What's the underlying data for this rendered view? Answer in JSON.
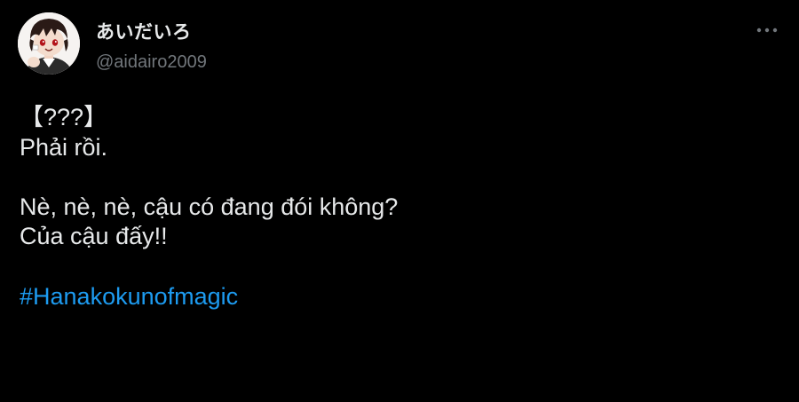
{
  "tweet": {
    "author": {
      "display_name": "あいだいろ",
      "handle": "@aidairo2009"
    },
    "more_icon": "more-horizontal-icon",
    "lines": {
      "l1": "【???】",
      "l2": "Phải rồi.",
      "l3": "Nè, nè, nè, cậu có đang đói không?",
      "l4": "Của cậu đấy!!"
    },
    "hashtag": "#Hanakokunofmagic"
  },
  "colors": {
    "background": "#000000",
    "text": "#e7e9ea",
    "handle": "#71767b",
    "hashtag": "#1d9bf0"
  }
}
